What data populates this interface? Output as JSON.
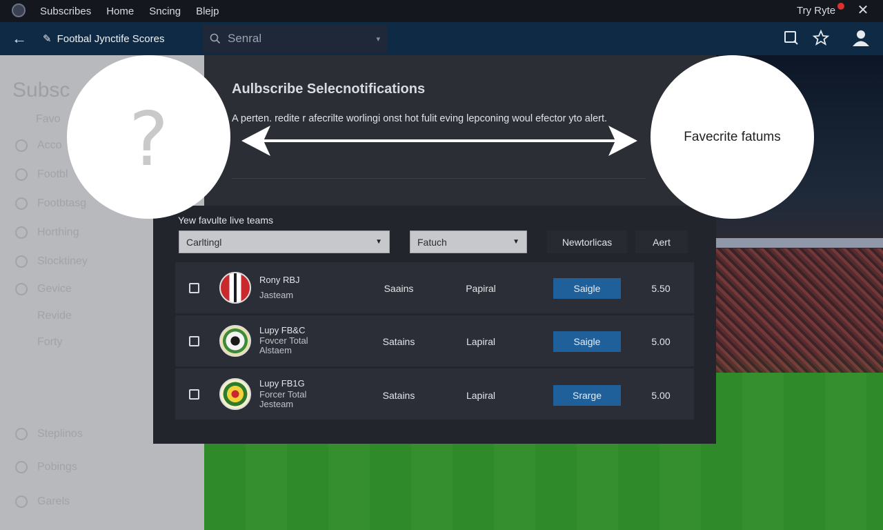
{
  "topbar": {
    "nav": [
      "Subscribes",
      "Home",
      "Sncing",
      "Blejp"
    ],
    "user": "Try Ryte",
    "close_glyph": "✕"
  },
  "navbar": {
    "back_glyph": "←",
    "title": "Footbal Jynctife Scores",
    "search_placeholder": "Senral",
    "icons": [
      "search-icon",
      "star-icon",
      "user-icon"
    ]
  },
  "sidebar_ghost": {
    "title": "Subsc",
    "items": [
      "Favo",
      "Acco",
      "Footbl",
      "Footbtasg",
      "Horthing",
      "Slocktiney",
      "Gevice",
      "Revide",
      "Forty"
    ],
    "bottom_items": [
      "Steplinos",
      "Pobings",
      "Garels"
    ]
  },
  "dialog": {
    "title": "Aulbscribe Selecnotifications",
    "description": "A perten. redite r afecrilte worlingi onst hot fulit eving lepconing woul efector yto alert."
  },
  "circles": {
    "left_glyph": "?",
    "right_label": "Favecrite fatums"
  },
  "panel": {
    "section_label": "Yew favulte live teams",
    "select1": "Carltingl",
    "select2": "Fatuch",
    "btn_networks": "Newtorlicas",
    "btn_alert": "Aert",
    "rows": [
      {
        "name": "Rony RBJ",
        "sub1": "Jasteam",
        "sub2": "",
        "col1": "Saains",
        "col2": "Papiral",
        "action": "Saigle",
        "value": "5.50",
        "crest": "red"
      },
      {
        "name": "Lupy FB&C",
        "sub1": "Fovcer Total",
        "sub2": "Alstaem",
        "col1": "Satains",
        "col2": "Lapiral",
        "action": "Saigle",
        "value": "5.00",
        "crest": "green"
      },
      {
        "name": "Lupy FB1G",
        "sub1": "Forcer Total",
        "sub2": "Jesteam",
        "col1": "Satains",
        "col2": "Lapiral",
        "action": "Srarge",
        "value": "5.00",
        "crest": "yellow"
      }
    ]
  }
}
